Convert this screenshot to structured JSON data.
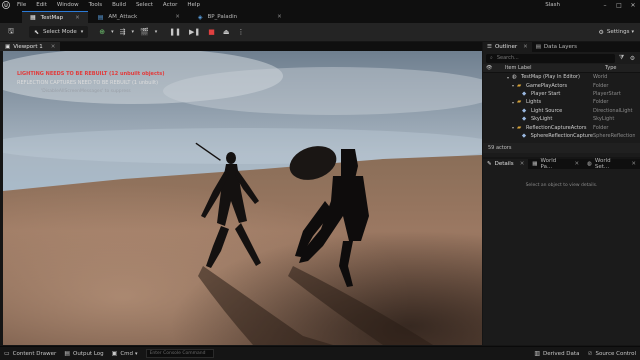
{
  "menu": {
    "items": [
      "File",
      "Edit",
      "Window",
      "Tools",
      "Build",
      "Select",
      "Actor",
      "Help"
    ],
    "project": "Slash"
  },
  "tabs": [
    {
      "label": "TestMap",
      "icon": "level-icon",
      "active": true
    },
    {
      "label": "AM_Attack",
      "icon": "montage-icon",
      "active": false
    },
    {
      "label": "BP_Paladin",
      "icon": "blueprint-icon",
      "active": false
    }
  ],
  "toolbar": {
    "mode_label": "Select Mode",
    "settings_label": "Settings"
  },
  "viewport": {
    "tab_label": "Viewport 1",
    "warning_lighting": "LIGHTING NEEDS TO BE REBUILT (12 unbuilt objects)",
    "warning_reflection": "REFLECTION CAPTURES NEED TO BE REBUILT (1 unbuilt)",
    "warning_note": "'DisableAllScreenMessages' to suppress"
  },
  "outliner": {
    "tab_label": "Outliner",
    "data_layers_label": "Data Layers",
    "search_placeholder": "Search...",
    "col_label": "Item Label",
    "col_type": "Type",
    "rows": [
      {
        "indent": 0,
        "label": "TestMap (Play In Editor)",
        "type": "World",
        "kind": "world"
      },
      {
        "indent": 1,
        "label": "GamePlayActors",
        "type": "Folder",
        "kind": "folder"
      },
      {
        "indent": 2,
        "label": "Player Start",
        "type": "PlayerStart",
        "kind": "actor"
      },
      {
        "indent": 1,
        "label": "Lights",
        "type": "Folder",
        "kind": "folder"
      },
      {
        "indent": 2,
        "label": "Light Source",
        "type": "DirectionalLight",
        "kind": "actor"
      },
      {
        "indent": 2,
        "label": "SkyLight",
        "type": "SkyLight",
        "kind": "actor"
      },
      {
        "indent": 1,
        "label": "ReflectionCaptureActors",
        "type": "Folder",
        "kind": "folder"
      },
      {
        "indent": 2,
        "label": "SphereReflectionCapture",
        "type": "SphereReflectionCapture",
        "kind": "actor"
      }
    ],
    "actor_count": "59 actors"
  },
  "details": {
    "tabs": [
      "Details",
      "World Pa...",
      "World Set..."
    ],
    "empty_message": "Select an object to view details."
  },
  "bottombar": {
    "content_drawer": "Content Drawer",
    "output_log": "Output Log",
    "cmd": "Cmd",
    "console_placeholder": "Enter Console Command",
    "derived_data": "Derived Data",
    "source_control": "Source Control"
  },
  "colors": {
    "accent": "#2c7ad6",
    "warning_red": "#e23b3b",
    "folder": "#d9a43a"
  }
}
